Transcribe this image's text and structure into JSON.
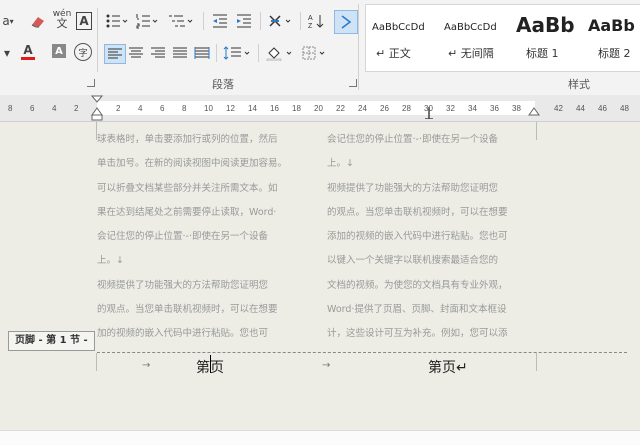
{
  "ribbon": {
    "row1_labels": [
      "a",
      "wén",
      "A"
    ],
    "font_color_label": "A",
    "styles": [
      {
        "preview": "AaBbCcDd",
        "name": "正文"
      },
      {
        "preview": "AaBbCcDd",
        "name": "无间隔"
      },
      {
        "preview": "AaBb",
        "name": "标题 1"
      },
      {
        "preview": "AaBb",
        "name": "标题 2"
      }
    ],
    "group_paragraph": "段落",
    "group_styles": "样式"
  },
  "ruler": {
    "left_ticks": [
      "8",
      "6",
      "4",
      "2"
    ],
    "ticks": [
      "2",
      "4",
      "6",
      "8",
      "10",
      "12",
      "14",
      "16",
      "18",
      "20",
      "22",
      "24",
      "26",
      "28",
      "30",
      "32",
      "34",
      "36",
      "38"
    ],
    "right_ticks": [
      "42",
      "44",
      "46",
      "48"
    ]
  },
  "document": {
    "col1": [
      "球表格时，单击要添加行或列的位置，然后",
      "单击加号。在新的阅读视图中阅读更加容易。",
      "可以折叠文档某些部分并关注所需文本。如",
      "果在达到结尾处之前需要停止读取，Word·",
      "会记住您的停止位置·-·即使在另一个设备",
      "上。↓",
      "视频提供了功能强大的方法帮助您证明您",
      "的观点。当您单击联机视频时，可以在想要",
      "加的视频的嵌入代码中进行粘贴。您也可"
    ],
    "col2": [
      "会记住您的停止位置·-·即使在另一个设备",
      "上。↓",
      "视频提供了功能强大的方法帮助您证明您",
      "的观点。当您单击联机视频时，可以在想要",
      "添加的视频的嵌入代码中进行粘贴。您也可",
      "以键入一个关键字以联机搜索最适合您的",
      "文档的视频。为使您的文档具有专业外观，",
      "Word·提供了页眉、页脚、封面和文本框设",
      "计，这些设计可互为补充。例如，您可以添"
    ],
    "footer_tag": "页脚 - 第 1 节 -",
    "footer_left": "第页",
    "footer_right": "第页↵"
  }
}
